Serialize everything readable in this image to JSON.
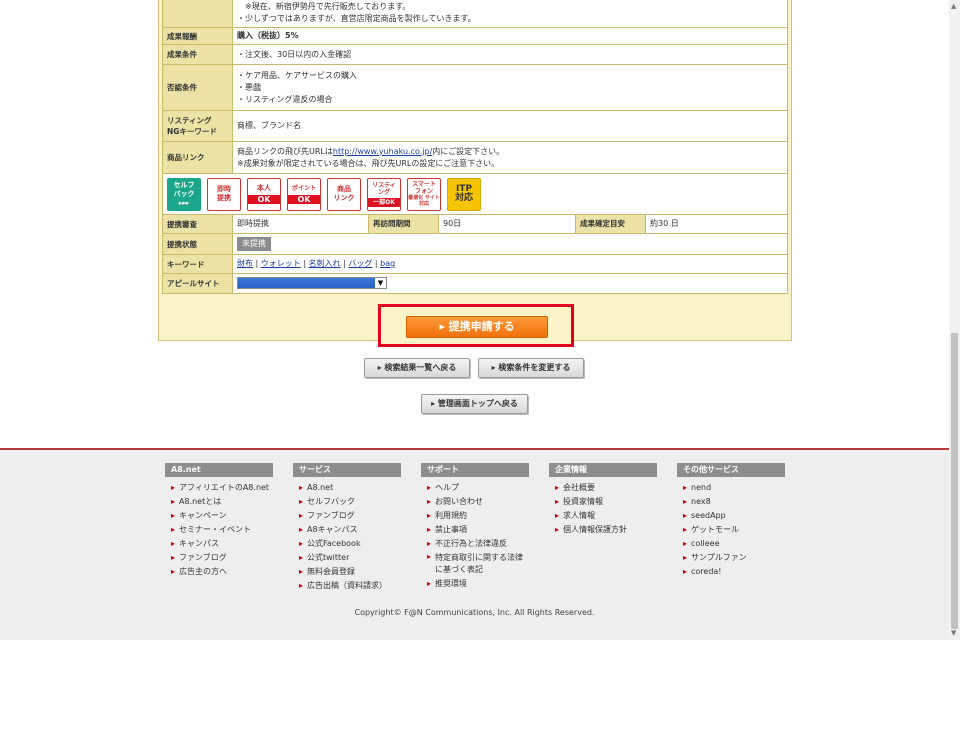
{
  "program": {
    "notes": [
      "※現在、新宿伊勢丹で先行販売しております。",
      "・少しずつではありますが、直営店限定商品を製作していきます。"
    ],
    "reward_label": "成果報酬",
    "reward_value": "購入（税抜）5%",
    "condition_label": "成果条件",
    "condition_value": "・注文後、30日以内の入金確認",
    "reject_label": "否認条件",
    "reject_values": [
      "・ケア用品、ケアサービスの購入",
      "・悪戯",
      "・リスティング違反の場合"
    ],
    "ng_label_1": "リスティング",
    "ng_label_2": "NGキーワード",
    "ng_value": "商標、ブランド名",
    "link_label": "商品リンク",
    "link_line1_pre": "商品リンクの飛び先URLは",
    "link_url": "http://www.yuhaku.co.jp/",
    "link_line1_post": "内にご設定下さい。",
    "link_line2": "※成果対象が限定されている場合は、飛び先URLの設定にご注意下さい。",
    "icons": [
      {
        "name": "self-back-icon",
        "top": "セルフ",
        "mid": "バック",
        "bot": "▸▸▸"
      },
      {
        "name": "instant-partner-icon",
        "top": "即時",
        "mid": "提携"
      },
      {
        "name": "identity-ok-icon",
        "top": "本人",
        "bot": "OK"
      },
      {
        "name": "point-ok-icon",
        "top": "ポイント",
        "bot": "OK"
      },
      {
        "name": "product-link-icon",
        "top": "商品",
        "mid": "リンク"
      },
      {
        "name": "listing-partial-ok-icon",
        "top": "リスティ",
        "mid": "ング",
        "bot": "一部OK"
      },
      {
        "name": "smartphone-optimized-icon",
        "top": "スマート",
        "mid": "フォン",
        "bot": "最適化 サイト対応"
      },
      {
        "name": "itp-support-icon",
        "top": "ITP",
        "mid": "対応"
      }
    ],
    "review_label": "提携審査",
    "review_value": "即時提携",
    "revisit_label": "再訪問期間",
    "revisit_value": "90日",
    "confirm_label": "成果確定目安",
    "confirm_value": "約30 日",
    "status_label": "提携状態",
    "status_value": "未提携",
    "keyword_label": "キーワード",
    "keywords": [
      "財布",
      "ウォレット",
      "名刺入れ",
      "バッグ",
      "bag"
    ],
    "appeal_label": "アピールサイト"
  },
  "actions": {
    "apply": "▸ 提携申請する",
    "back_to_results": "▸ 検索結果一覧へ戻る",
    "change_conditions": "▸ 検索条件を変更する",
    "back_to_top": "▸ 管理画面トップへ戻る"
  },
  "footer": {
    "columns": [
      {
        "title": "A8.net",
        "items": [
          "アフィリエイトのA8.net",
          "A8.netとは",
          "キャンペーン",
          "セミナー・イベント",
          "キャンパス",
          "ファンブログ",
          "広告主の方へ"
        ]
      },
      {
        "title": "サービス",
        "items": [
          "A8.net",
          "セルフバック",
          "ファンブログ",
          "A8キャンパス",
          "公式Facebook",
          "公式twitter",
          "無料会員登録",
          "広告出稿（資料請求）"
        ]
      },
      {
        "title": "サポート",
        "items": [
          "ヘルプ",
          "お問い合わせ",
          "利用規約",
          "禁止事項",
          "不正行為と法律違反",
          "特定商取引に関する法律に基づく表記",
          "推奨環境"
        ]
      },
      {
        "title": "企業情報",
        "items": [
          "会社概要",
          "投資家情報",
          "求人情報",
          "個人情報保護方針"
        ]
      },
      {
        "title": "その他サービス",
        "items": [
          "nend",
          "nex8",
          "seedApp",
          "ゲットモール",
          "colleee",
          "サンプルファン",
          "coreda!"
        ]
      }
    ],
    "copyright": "Copyright© F@N Communications, Inc. All Rights Reserved."
  }
}
